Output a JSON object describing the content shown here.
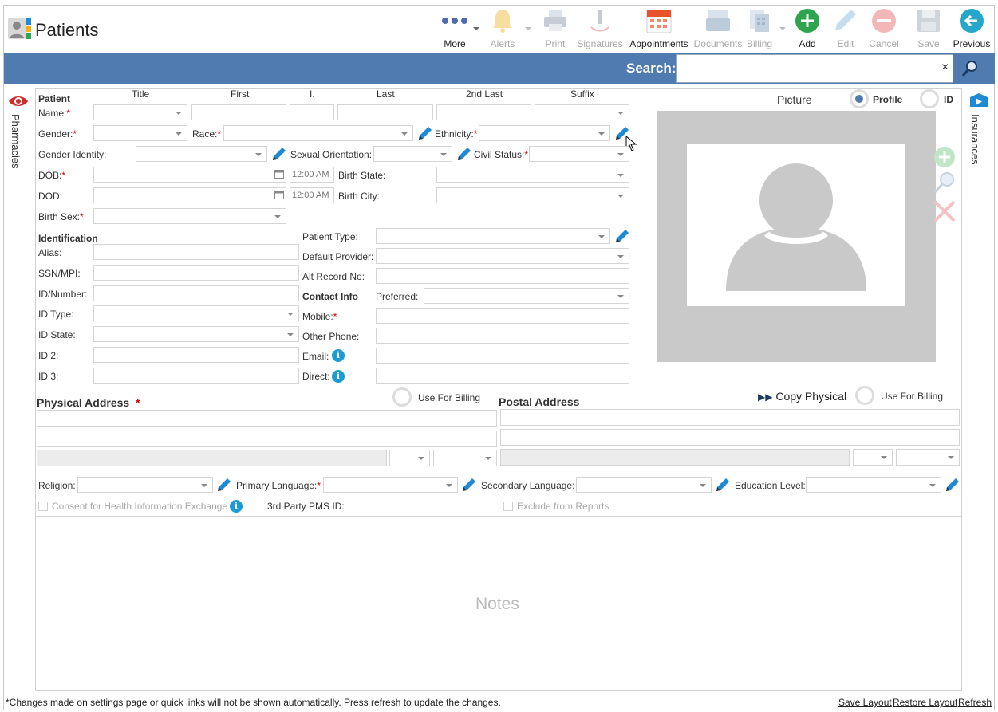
{
  "app": {
    "title": "Patients"
  },
  "toolbar": {
    "more": "More",
    "alerts": "Alerts",
    "print": "Print",
    "signatures": "Signatures",
    "appointments": "Appointments",
    "documents": "Documents",
    "billing": "Billing",
    "add": "Add",
    "edit": "Edit",
    "cancel": "Cancel",
    "save": "Save",
    "previous": "Previous"
  },
  "search": {
    "label": "Search:",
    "value": "",
    "clear": "×"
  },
  "side_tabs": {
    "left": "Pharmacies",
    "right": "Insurances"
  },
  "patient": {
    "section": "Patient",
    "col_title": "Title",
    "col_first": "First",
    "col_initial": "I.",
    "col_last": "Last",
    "col_second_last": "2nd Last",
    "col_suffix": "Suffix",
    "name_label": "Name:",
    "gender_label": "Gender:",
    "race_label": "Race:",
    "ethnicity_label": "Ethnicity:",
    "gender_identity_label": "Gender Identity:",
    "sexual_orientation_label": "Sexual Orientation:",
    "civil_status_label": "Civil Status:",
    "dob_label": "DOB:",
    "dod_label": "DOD:",
    "time_placeholder": "12:00 AM",
    "birth_state_label": "Birth State:",
    "birth_city_label": "Birth City:",
    "birth_sex_label": "Birth Sex:",
    "required_mark": "*"
  },
  "identification": {
    "section": "Identification",
    "alias_label": "Alias:",
    "ssn_label": "SSN/MPI:",
    "id_number_label": "ID/Number:",
    "id_type_label": "ID Type:",
    "id_state_label": "ID State:",
    "id2_label": "ID 2:",
    "id3_label": "ID 3:"
  },
  "patient_info": {
    "patient_type_label": "Patient Type:",
    "default_provider_label": "Default Provider:",
    "alt_record_label": "Alt Record No:",
    "contact_info": "Contact Info",
    "preferred_label": "Preferred:",
    "mobile_label": "Mobile:",
    "other_phone_label": "Other Phone:",
    "email_label": "Email:",
    "direct_label": "Direct:",
    "info_glyph": "i"
  },
  "picture": {
    "title": "Picture",
    "profile": "Profile",
    "id": "ID"
  },
  "physical_address": {
    "title": "Physical Address",
    "use_for_billing": "Use For Billing"
  },
  "postal_address": {
    "title": "Postal Address",
    "copy_physical": "Copy Physical",
    "use_for_billing": "Use For Billing"
  },
  "other": {
    "religion_label": "Religion:",
    "primary_language_label": "Primary Language:",
    "secondary_language_label": "Secondary Language:",
    "education_level_label": "Education Level:",
    "consent_label": "Consent for Health Information Exchange",
    "pms_id_label": "3rd Party PMS ID:",
    "exclude_label": "Exclude from Reports"
  },
  "notes": {
    "placeholder": "Notes"
  },
  "footer": {
    "notice": "*Changes made on settings page or quick links will not be shown automatically. Press refresh to update the changes.",
    "save_layout": "Save Layout",
    "restore_layout": "Restore Layout",
    "refresh": "Refresh"
  },
  "colors": {
    "accent": "#4f7bb0",
    "required": "#d00000",
    "add_green": "#2ea44f",
    "previous_teal": "#26a7c9",
    "info_blue": "#1a9bd7",
    "calendar_orange": "#e8532b"
  }
}
